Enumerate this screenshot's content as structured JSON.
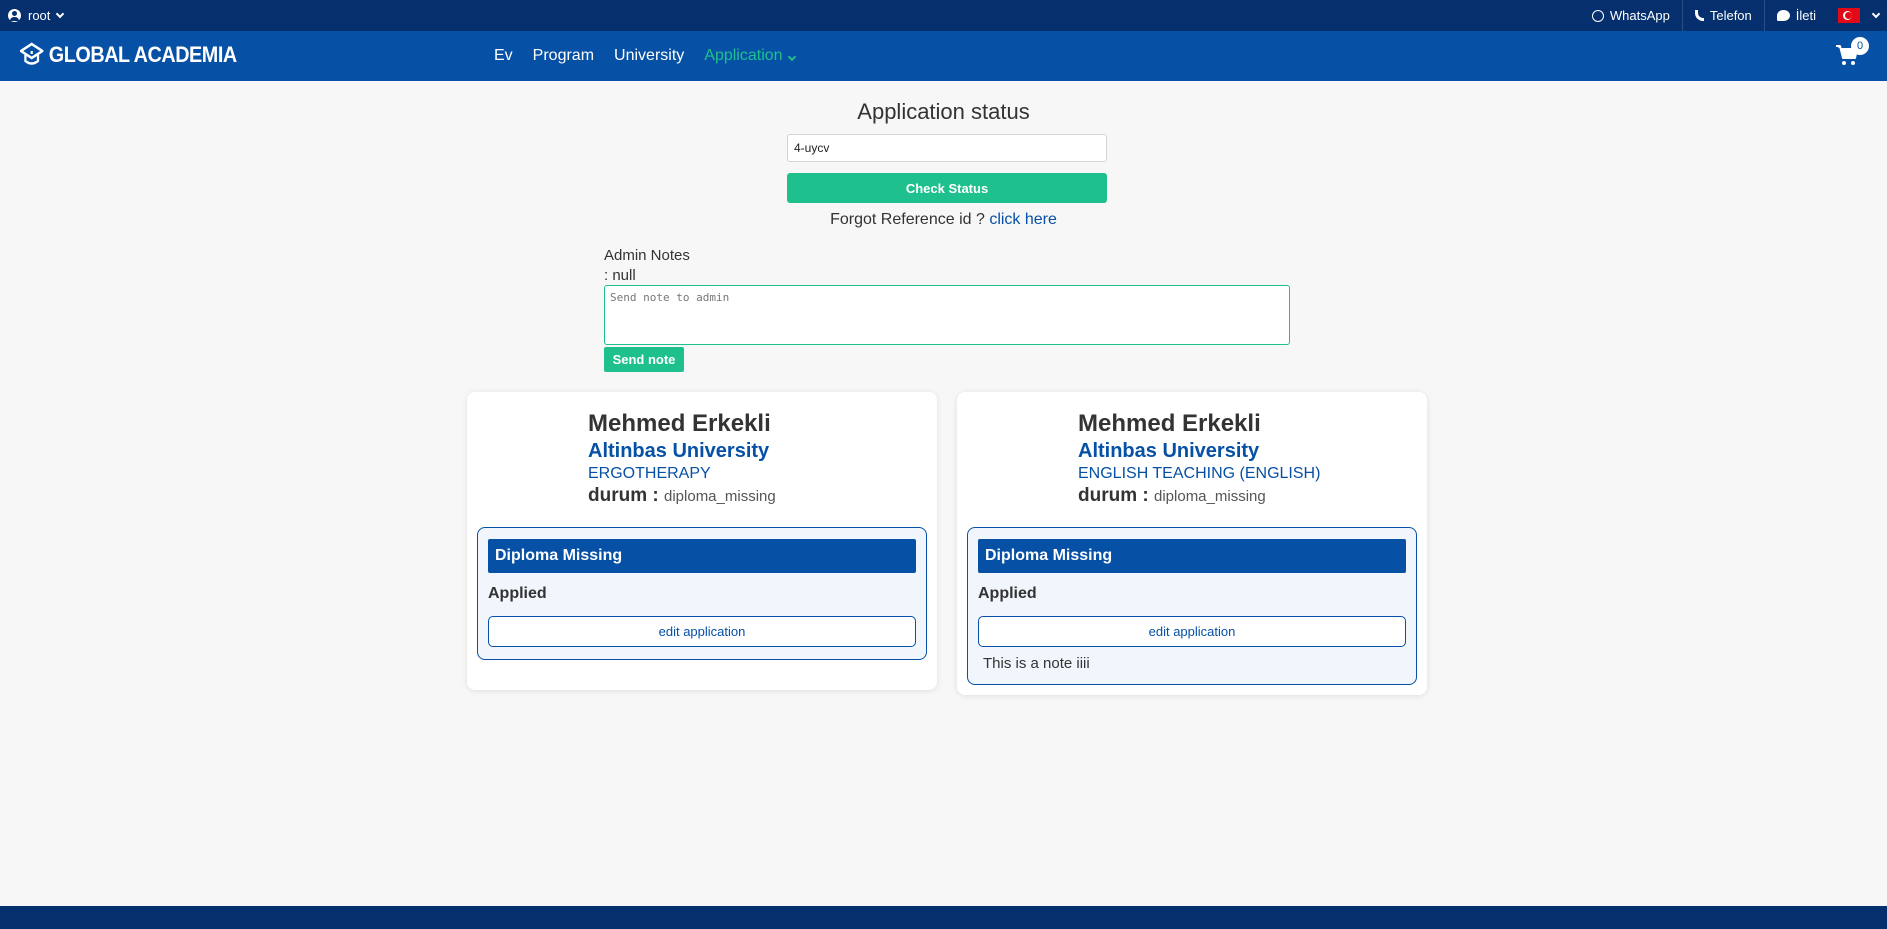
{
  "topbar": {
    "user": "root",
    "links": [
      {
        "label": "WhatsApp",
        "icon": "whatsapp-icon"
      },
      {
        "label": "Telefon",
        "icon": "phone-icon"
      },
      {
        "label": "İleti",
        "icon": "message-icon"
      }
    ]
  },
  "navbar": {
    "brand": "GLOBAL ACADEMIA",
    "links": [
      "Ev",
      "Program",
      "University",
      "Application"
    ],
    "cart_count": "0"
  },
  "status": {
    "title": "Application status",
    "reference_value": "4-uycv",
    "check_button": "Check Status",
    "forgot_text": "Forgot Reference id ?",
    "forgot_link": "click here"
  },
  "admin": {
    "label": "Admin Notes",
    "value": ": null",
    "placeholder": "Send note to admin",
    "send_button": "Send note"
  },
  "applications": [
    {
      "name": "Mehmed Erkekli",
      "university": "Altinbas University",
      "program": "ERGOTHERAPY",
      "durum_label": "durum :",
      "durum_value": "diploma_missing",
      "status": "Diploma Missing",
      "state": "Applied",
      "edit_button": "edit application",
      "note": ""
    },
    {
      "name": "Mehmed Erkekli",
      "university": "Altinbas University",
      "program": "ENGLISH TEACHING (ENGLISH)",
      "durum_label": "durum :",
      "durum_value": "diploma_missing",
      "status": "Diploma Missing",
      "state": "Applied",
      "edit_button": "edit application",
      "note": "This is a note iiii"
    }
  ],
  "colors": {
    "topbar": "#062f6e",
    "navbar": "#0650a5",
    "accent_green": "#1ec08d"
  }
}
